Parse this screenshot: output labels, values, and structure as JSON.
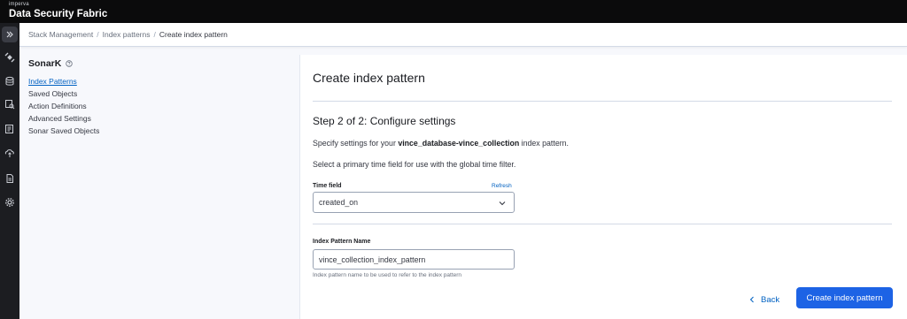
{
  "header": {
    "vendor": "imperva",
    "title": "Data Security Fabric"
  },
  "rail": {
    "icons": [
      "expand-icon",
      "satellite-icon",
      "database-icon",
      "search-database-icon",
      "audit-icon",
      "cloud-upload-icon",
      "document-icon",
      "gear-icon"
    ]
  },
  "breadcrumbs": [
    "Stack Management",
    "Index patterns",
    "Create index pattern"
  ],
  "sidebar": {
    "title": "SonarK",
    "items": [
      {
        "label": "Index Patterns",
        "active": true
      },
      {
        "label": "Saved Objects"
      },
      {
        "label": "Action Definitions"
      },
      {
        "label": "Advanced Settings"
      },
      {
        "label": "Sonar Saved Objects"
      }
    ]
  },
  "main": {
    "title": "Create index pattern",
    "step_title": "Step 2 of 2: Configure settings",
    "desc_prefix": "Specify settings for your ",
    "index_name": "vince_database-vince_collection",
    "desc_suffix": " index pattern.",
    "desc2": "Select a primary time field for use with the global time filter.",
    "time_field": {
      "label": "Time field",
      "refresh": "Refresh",
      "value": "created_on"
    },
    "pattern_name": {
      "label": "Index Pattern Name",
      "value": "vince_collection_index_pattern",
      "help": "Index pattern name to be used to refer to the index pattern"
    },
    "back_label": "Back",
    "create_label": "Create index pattern"
  },
  "colors": {
    "accent": "#1d63e5",
    "link": "#0061c2",
    "topbar": "#0b0b0c",
    "rail": "#1c1d21"
  }
}
